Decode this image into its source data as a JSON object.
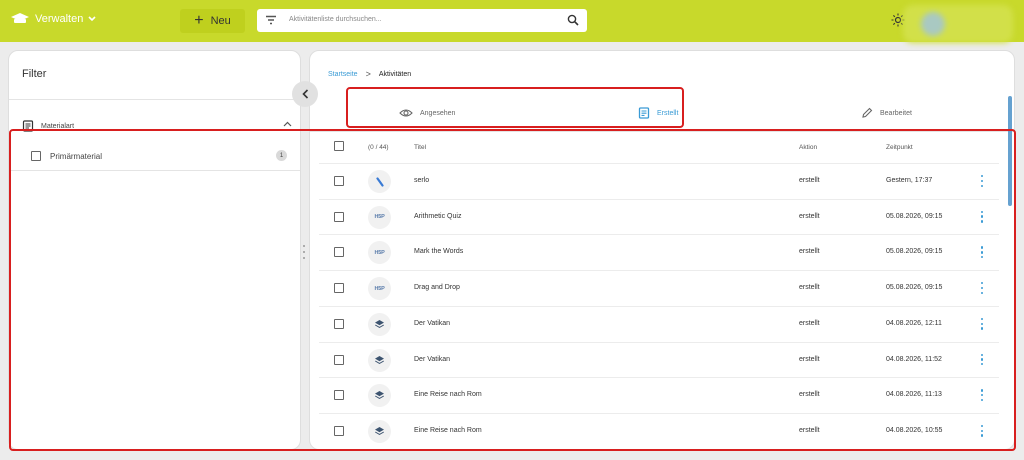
{
  "header": {
    "brand_label": "Verwalten",
    "new_label": "Neu",
    "search_placeholder": "Aktivitätenliste durchsuchen..."
  },
  "sidebar": {
    "title": "Filter",
    "section_label": "Materialart",
    "option": {
      "label": "Primärmaterial",
      "count": "1"
    }
  },
  "breadcrumb": {
    "home": "Startseite",
    "separator": ">",
    "current": "Aktivitäten"
  },
  "tabs": [
    {
      "label": "Angesehen",
      "icon": "eye-icon"
    },
    {
      "label": "Erstellt",
      "icon": "document-icon",
      "active": true
    },
    {
      "label": "Bearbeitet",
      "icon": "pencil-icon"
    }
  ],
  "table": {
    "count_label": "(0 / 44)",
    "headers": {
      "title": "Titel",
      "action": "Aktion",
      "time": "Zeitpunkt"
    },
    "rows": [
      {
        "icon": "serlo",
        "title": "serlo",
        "action": "erstellt",
        "time": "Gestern, 17:37"
      },
      {
        "icon": "h5p",
        "title": "Arithmetic Quiz",
        "action": "erstellt",
        "time": "05.08.2026, 09:15"
      },
      {
        "icon": "h5p",
        "title": "Mark the Words",
        "action": "erstellt",
        "time": "05.08.2026, 09:15"
      },
      {
        "icon": "h5p",
        "title": "Drag and Drop",
        "action": "erstellt",
        "time": "05.08.2026, 09:15"
      },
      {
        "icon": "layers",
        "title": "Der Vatikan",
        "action": "erstellt",
        "time": "04.08.2026, 12:11"
      },
      {
        "icon": "layers",
        "title": "Der Vatikan",
        "action": "erstellt",
        "time": "04.08.2026, 11:52"
      },
      {
        "icon": "layers",
        "title": "Eine Reise nach Rom",
        "action": "erstellt",
        "time": "04.08.2026, 11:13"
      },
      {
        "icon": "layers",
        "title": "Eine Reise nach Rom",
        "action": "erstellt",
        "time": "04.08.2026, 10:55"
      }
    ]
  },
  "colors": {
    "topbar": "#c8d92b",
    "accent": "#3a9bd5",
    "highlight": "#d81f1f"
  }
}
